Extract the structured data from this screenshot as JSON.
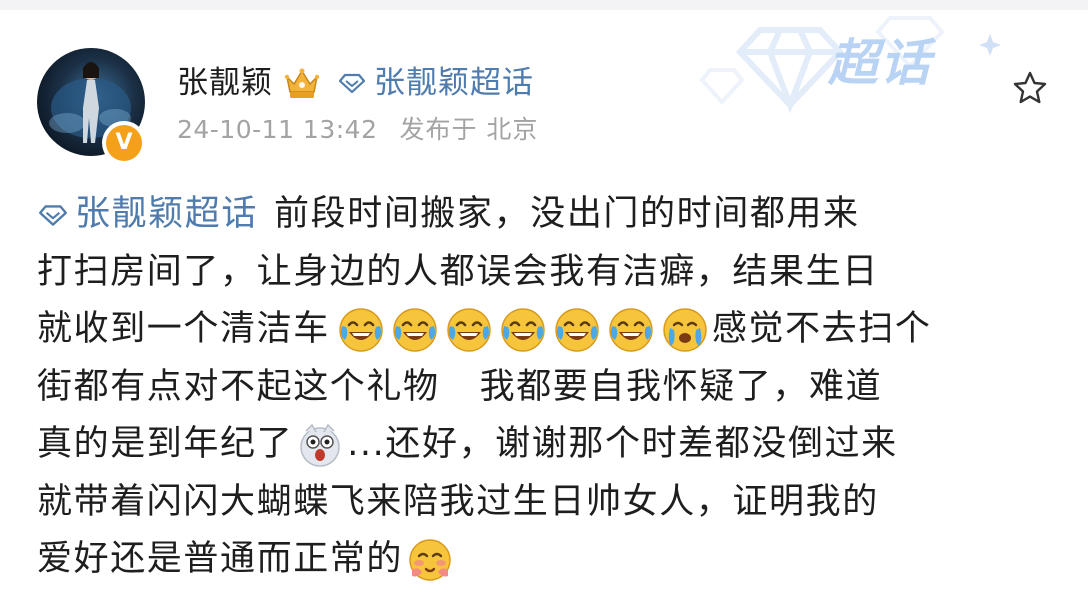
{
  "post": {
    "author_name": "张靓颖",
    "topic_label": "张靓颖超话",
    "timestamp": "24-10-11 13:42",
    "location": "发布于 北京",
    "verified_badge": "V",
    "topic_brand": "超话",
    "lines": {
      "l1_topic": "张靓颖超话",
      "l1_text": "前段时间搬家，没出门的时间都用来",
      "l2_text": "打扫房间了，让身边的人都误会我有洁癖，结果生日",
      "l3_text_a": "就收到一个清洁车",
      "l3_text_b": "感觉不去扫个",
      "l4_text_a": "街都有点对不起这个礼物",
      "l4_text_b": "我都要自我怀疑了，难道",
      "l5_text_a": "真的是到年纪了",
      "l5_text_b": "...还好，谢谢那个时差都没倒过来",
      "l6_text": "就带着闪闪大蝴蝶飞来陪我过生日帅女人，证明我的",
      "l7_text": "爱好还是普通而正常的"
    },
    "emojis": {
      "laugh_cry_count": 6,
      "after_laughs": "crying-face",
      "after_age": "shocked-face",
      "final": "kissing-hug-face"
    }
  },
  "colors": {
    "link": "#4f7cad",
    "text": "#1e1e1e",
    "meta": "#a3a3a3",
    "topic_brand": "#b9d3f5",
    "badge": "#f5a01a"
  },
  "icons": {
    "star": "star-outline-icon",
    "crown": "crown-icon",
    "diamond": "diamond-topic-icon"
  }
}
